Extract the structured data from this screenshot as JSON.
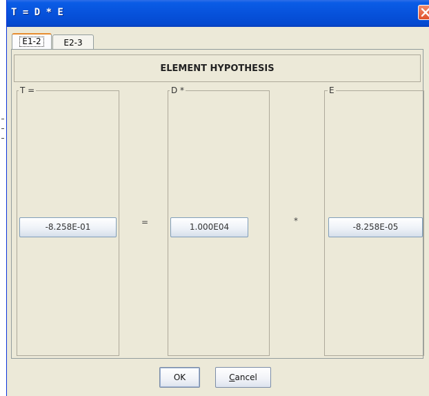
{
  "window": {
    "title": "T = D * E"
  },
  "tabs": [
    {
      "label": "E1-2",
      "active": true
    },
    {
      "label": "E2-3",
      "active": false
    }
  ],
  "heading": "ELEMENT HYPOTHESIS",
  "groups": {
    "t": {
      "title": "T =",
      "value": "-8.258E-01"
    },
    "d": {
      "title": "D *",
      "value": "1.000E04"
    },
    "e": {
      "title": "E",
      "value": "-8.258E-05"
    }
  },
  "operators": {
    "equals": "=",
    "times": "*"
  },
  "footer": {
    "ok_label": "OK",
    "cancel_first_letter": "C",
    "cancel_rest": "ancel"
  },
  "colors": {
    "titlebar": "#0752db",
    "dialog_bg": "#ece9d8",
    "close_button": "#e0502a",
    "active_tab_accent": "#e68b2c"
  },
  "icons": {
    "close": "close-icon"
  }
}
